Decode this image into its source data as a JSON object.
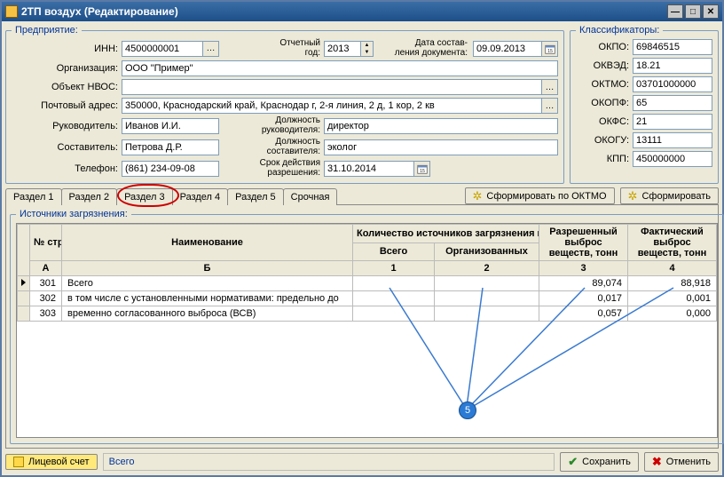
{
  "window": {
    "title": "2ТП воздух (Редактирование)"
  },
  "enterprise": {
    "legend": "Предприятие:",
    "inn_label": "ИНН:",
    "inn": "4500000001",
    "year_label": "Отчетный год:",
    "year": "2013",
    "docdate_label": "Дата состав-\nления документа:",
    "docdate": "09.09.2013",
    "org_label": "Организация:",
    "org": "ООО \"Пример\"",
    "nvos_label": "Объект НВОС:",
    "nvos": "",
    "addr_label": "Почтовый адрес:",
    "addr": "350000, Краснодарский край, Краснодар г, 2-я линия, 2 д, 1 кор, 2 кв",
    "head_label": "Руководитель:",
    "head": "Иванов И.И.",
    "headpos_label": "Должность руководителя:",
    "headpos": "директор",
    "author_label": "Составитель:",
    "author": "Петрова Д.Р.",
    "authorpos_label": "Должность составителя:",
    "authorpos": "эколог",
    "phone_label": "Телефон:",
    "phone": "(861) 234-09-08",
    "permexp_label": "Срок действия разрешения:",
    "permexp": "31.10.2014"
  },
  "classifiers": {
    "legend": "Классификаторы:",
    "okpo_label": "ОКПО:",
    "okpo": "69846515",
    "okved_label": "ОКВЭД:",
    "okved": "18.21",
    "oktmo_label": "ОКТМО:",
    "oktmo": "03701000000",
    "okopf_label": "ОКОПФ:",
    "okopf": "65",
    "okfs_label": "ОКФС:",
    "okfs": "21",
    "okogu_label": "ОКОГУ:",
    "okogu": "13111",
    "kpp_label": "КПП:",
    "kpp": "450000000"
  },
  "tabs": [
    "Раздел 1",
    "Раздел 2",
    "Раздел 3",
    "Раздел 4",
    "Раздел 5",
    "Срочная"
  ],
  "active_tab_index": 2,
  "oktmo_btn": "Сформировать по ОКТМО",
  "form_btn": "Сформировать",
  "sources": {
    "legend": "Источники загрязнения:",
    "headers": {
      "rownum": "№ стр.",
      "name": "Наименование",
      "count_group": "Количество источников загрязнения на конец года, единиц",
      "count_total": "Всего",
      "count_org": "Организованных",
      "allowed": "Разрешенный выброс веществ, тонн",
      "actual": "Фактический выброс веществ, тонн",
      "subA": "А",
      "subB": "Б",
      "c1": "1",
      "c2": "2",
      "c3": "3",
      "c4": "4"
    },
    "rows": [
      {
        "n": "301",
        "name": "Всего",
        "total": "",
        "org": "",
        "allowed": "89,074",
        "actual": "88,918",
        "sel": true
      },
      {
        "n": "302",
        "name": "в том числе с установленными нормативами: предельно до",
        "total": "",
        "org": "",
        "allowed": "0,017",
        "actual": "0,001",
        "sel": false
      },
      {
        "n": "303",
        "name": "временно согласованного выброса (ВСВ)",
        "total": "",
        "org": "",
        "allowed": "0,057",
        "actual": "0,000",
        "sel": false
      }
    ]
  },
  "footer": {
    "account_btn": "Лицевой счет",
    "status": "Всего",
    "save": "Сохранить",
    "cancel": "Отменить"
  },
  "annotation_node": "5"
}
